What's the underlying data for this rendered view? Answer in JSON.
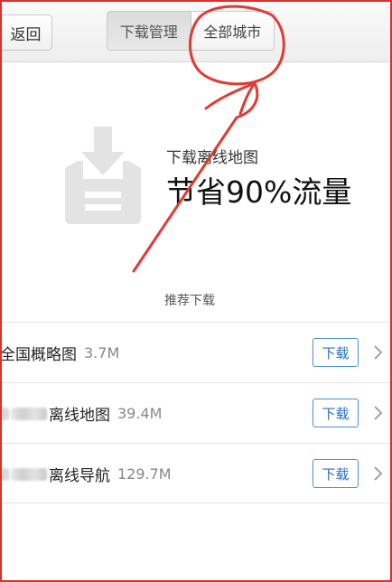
{
  "header": {
    "back_label": "返回",
    "tabs": [
      {
        "label": "下载管理",
        "active": true
      },
      {
        "label": "全部城市",
        "active": false
      }
    ]
  },
  "hero": {
    "subtitle": "下载离线地图",
    "title": "节省90%流量",
    "icon": "download-tray-icon"
  },
  "section_label": "推荐下载",
  "list": {
    "items": [
      {
        "name": "全国概略图",
        "size": "3.7M",
        "button": "下载",
        "blurred_prefix": false
      },
      {
        "name": "离线地图",
        "size": "39.4M",
        "button": "下载",
        "blurred_prefix": true
      },
      {
        "name": "离线导航",
        "size": "129.7M",
        "button": "下载",
        "blurred_prefix": true
      }
    ]
  },
  "colors": {
    "accent": "#2a6fc9",
    "annotation": "#e03a33",
    "icon_gray": "#e3e3e3"
  }
}
